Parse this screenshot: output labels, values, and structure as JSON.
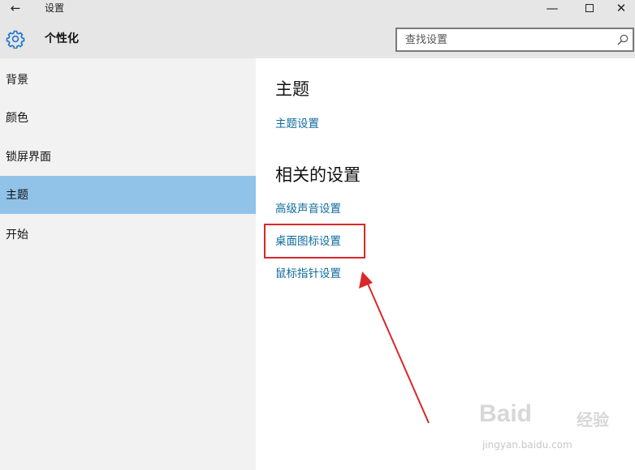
{
  "window": {
    "title": "设置",
    "back_icon": "←",
    "minimize_icon": "—",
    "close_icon": "✕"
  },
  "header": {
    "page_title": "个性化",
    "search_placeholder": "查找设置"
  },
  "sidebar": {
    "items": [
      {
        "label": "背景"
      },
      {
        "label": "颜色"
      },
      {
        "label": "锁屏界面"
      },
      {
        "label": "主题",
        "active": true
      },
      {
        "label": "开始"
      }
    ]
  },
  "main": {
    "theme_section": {
      "title": "主题",
      "link": "主题设置"
    },
    "related_section": {
      "title": "相关的设置",
      "links": [
        "高级声音设置",
        "桌面图标设置",
        "鼠标指针设置"
      ]
    }
  },
  "annotation": {
    "color": "#d9282a"
  },
  "watermark": {
    "logo": "Baid",
    "logo_sub": "经验",
    "url": "jingyan.baidu.com"
  },
  "colors": {
    "accent": "#91c3e9",
    "link": "#0e6b9c",
    "chrome": "#e6e6e6",
    "sidebar": "#f2f2f2"
  }
}
